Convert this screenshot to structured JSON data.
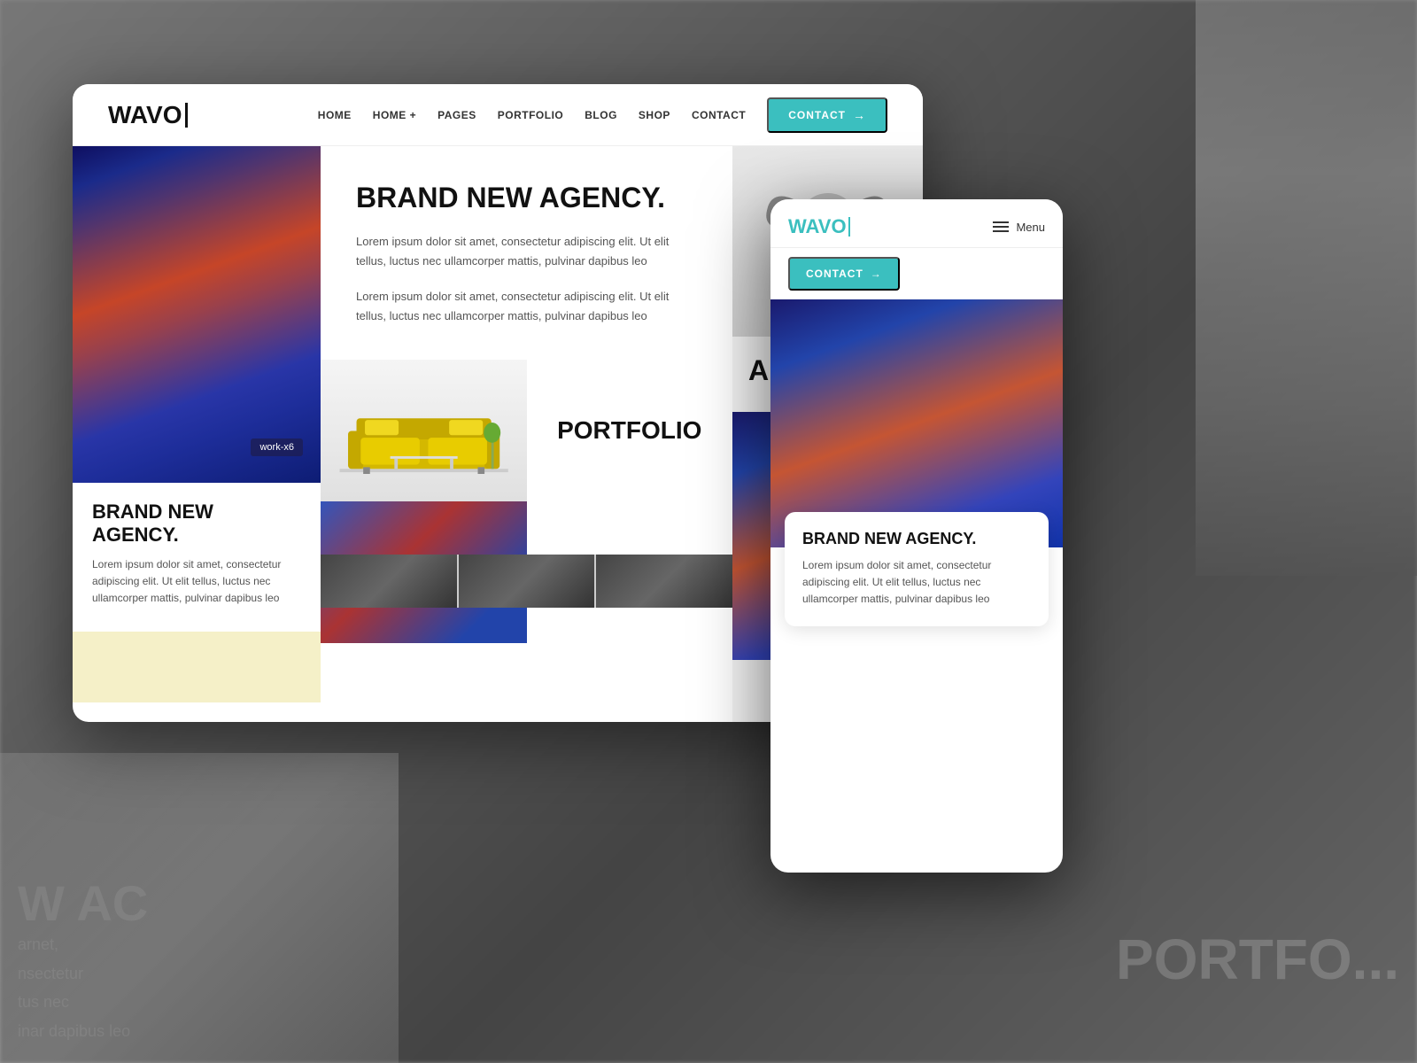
{
  "background": {
    "left_text_lines": [
      "W AC",
      "arnet,",
      "nsectetur",
      "tus nec",
      "inar dapibus leo"
    ],
    "right_text": "PORTFO..."
  },
  "desktop": {
    "nav": {
      "logo": "WAVO",
      "links": [
        "HOME",
        "HOME +",
        "PAGES",
        "PORTFOLIO",
        "BLOG",
        "SHOP",
        "CONTACT"
      ],
      "contact_btn": "CONTACT",
      "contact_arrow": "→"
    },
    "hero": {
      "title": "BRAND NEW AGENCY.",
      "para1": "Lorem ipsum dolor sit amet, consectetur adipiscing elit. Ut elit tellus, luctus nec ullamcorper mattis, pulvinar dapibus leo",
      "para2": "Lorem ipsum dolor sit amet, consectetur adipiscing elit. Ut elit tellus, luctus nec ullamcorper mattis, pulvinar dapibus leo",
      "work_badge": "work-x6"
    },
    "left_bottom": {
      "title": "BRAND NEW AGENCY.",
      "text": "Lorem ipsum dolor sit amet, consectetur adipiscing elit. Ut elit tellus, luctus nec ullamcorper mattis, pulvinar dapibus leo"
    },
    "portfolio": {
      "label": "PORTFOLIO"
    },
    "right_col": {
      "about": "ABO"
    }
  },
  "mobile": {
    "nav": {
      "logo": "WAVO",
      "menu_label": "Menu",
      "contact_btn": "CONTACT",
      "contact_arrow": "→"
    },
    "card": {
      "title": "BRAND NEW AGENCY.",
      "text": "Lorem ipsum dolor sit amet, consectetur adipiscing elit. Ut elit tellus, luctus nec ullamcorper mattis, pulvinar dapibus leo"
    }
  },
  "colors": {
    "teal": "#3bbfbf",
    "dark": "#111111",
    "text_gray": "#555555",
    "yellow_bg": "#f5f0c8",
    "white": "#ffffff"
  }
}
